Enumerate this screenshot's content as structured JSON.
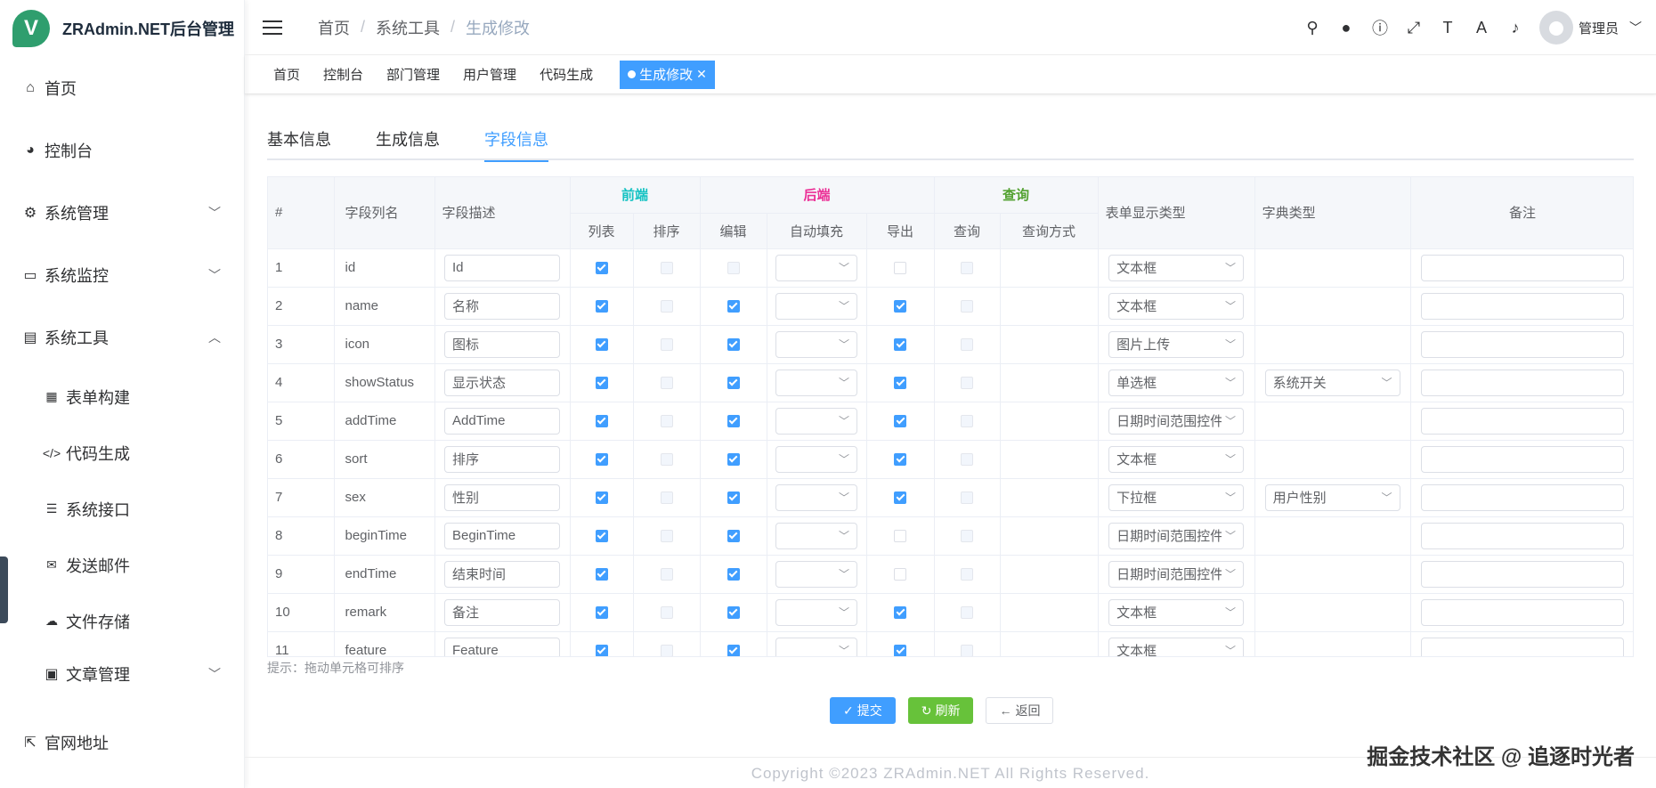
{
  "app": {
    "logo_letter": "V",
    "title": "ZRAdmin.NET后台管理"
  },
  "sidebar": {
    "items": [
      {
        "label": "首页",
        "icon": "home-icon"
      },
      {
        "label": "控制台",
        "icon": "dashboard-icon"
      },
      {
        "label": "系统管理",
        "icon": "gear-icon"
      },
      {
        "label": "系统监控",
        "icon": "monitor-icon"
      },
      {
        "label": "系统工具",
        "icon": "toolbox-icon"
      },
      {
        "label": "表单构建",
        "icon": "table-icon"
      },
      {
        "label": "代码生成",
        "icon": "code-icon"
      },
      {
        "label": "系统接口",
        "icon": "sliders-icon"
      },
      {
        "label": "发送邮件",
        "icon": "mail-icon"
      },
      {
        "label": "文件存储",
        "icon": "cloud-upload-icon"
      },
      {
        "label": "文章管理",
        "icon": "article-icon"
      },
      {
        "label": "官网地址",
        "icon": "external-link-icon"
      }
    ]
  },
  "breadcrumb": [
    "首页",
    "系统工具",
    "生成修改"
  ],
  "header": {
    "username": "管理员"
  },
  "tags": [
    "首页",
    "控制台",
    "部门管理",
    "用户管理",
    "代码生成",
    "生成修改"
  ],
  "tabs": [
    "基本信息",
    "生成信息",
    "字段信息"
  ],
  "table": {
    "headers": {
      "index": "#",
      "column_name": "字段列名",
      "description": "字段描述",
      "group_front": "前端",
      "group_back": "后端",
      "group_query": "查询",
      "list": "列表",
      "sort": "排序",
      "edit": "编辑",
      "autofill": "自动填充",
      "export": "导出",
      "query": "查询",
      "query_mode": "查询方式",
      "form_type": "表单显示类型",
      "dict_type": "字典类型",
      "remark": "备注"
    },
    "rows": [
      {
        "idx": "1",
        "name": "id",
        "desc": "Id",
        "list": true,
        "sort": false,
        "edit": false,
        "edit_disabled": true,
        "export": false,
        "query": false,
        "form": "文本框",
        "dict": ""
      },
      {
        "idx": "2",
        "name": "name",
        "desc": "名称",
        "list": true,
        "sort": false,
        "edit": true,
        "export": true,
        "query": false,
        "form": "文本框",
        "dict": ""
      },
      {
        "idx": "3",
        "name": "icon",
        "desc": "图标",
        "list": true,
        "sort": false,
        "edit": true,
        "export": true,
        "query": false,
        "form": "图片上传",
        "dict": ""
      },
      {
        "idx": "4",
        "name": "showStatus",
        "desc": "显示状态",
        "list": true,
        "sort": false,
        "edit": true,
        "export": true,
        "query": false,
        "form": "单选框",
        "dict": "系统开关"
      },
      {
        "idx": "5",
        "name": "addTime",
        "desc": "AddTime",
        "list": true,
        "sort": false,
        "edit": true,
        "export": true,
        "query": false,
        "form": "日期时间范围控件",
        "dict": ""
      },
      {
        "idx": "6",
        "name": "sort",
        "desc": "排序",
        "list": true,
        "sort": false,
        "edit": true,
        "export": true,
        "query": false,
        "form": "文本框",
        "dict": ""
      },
      {
        "idx": "7",
        "name": "sex",
        "desc": "性别",
        "list": true,
        "sort": false,
        "edit": true,
        "export": true,
        "query": false,
        "form": "下拉框",
        "dict": "用户性别"
      },
      {
        "idx": "8",
        "name": "beginTime",
        "desc": "BeginTime",
        "list": true,
        "sort": false,
        "edit": true,
        "export": false,
        "query": false,
        "form": "日期时间范围控件",
        "dict": ""
      },
      {
        "idx": "9",
        "name": "endTime",
        "desc": "结束时间",
        "list": true,
        "sort": false,
        "edit": true,
        "export": false,
        "query": false,
        "form": "日期时间范围控件",
        "dict": ""
      },
      {
        "idx": "10",
        "name": "remark",
        "desc": "备注",
        "list": true,
        "sort": false,
        "edit": true,
        "export": true,
        "query": false,
        "form": "文本框",
        "dict": ""
      },
      {
        "idx": "11",
        "name": "feature",
        "desc": "Feature",
        "list": true,
        "sort": false,
        "edit": true,
        "export": true,
        "query": false,
        "form": "文本框",
        "dict": ""
      }
    ]
  },
  "hint": "提示：拖动单元格可排序",
  "buttons": {
    "submit": "提交",
    "refresh": "刷新",
    "back": "返回"
  },
  "footer": "Copyright ©2023 ZRAdmin.NET All Rights Reserved.",
  "watermark": "掘金技术社区 @ 追逐时光者",
  "colors": {
    "primary": "#409eff",
    "success": "#67c23a",
    "front": "#13c2c2",
    "back": "#eb2f96",
    "query": "#52a130"
  }
}
